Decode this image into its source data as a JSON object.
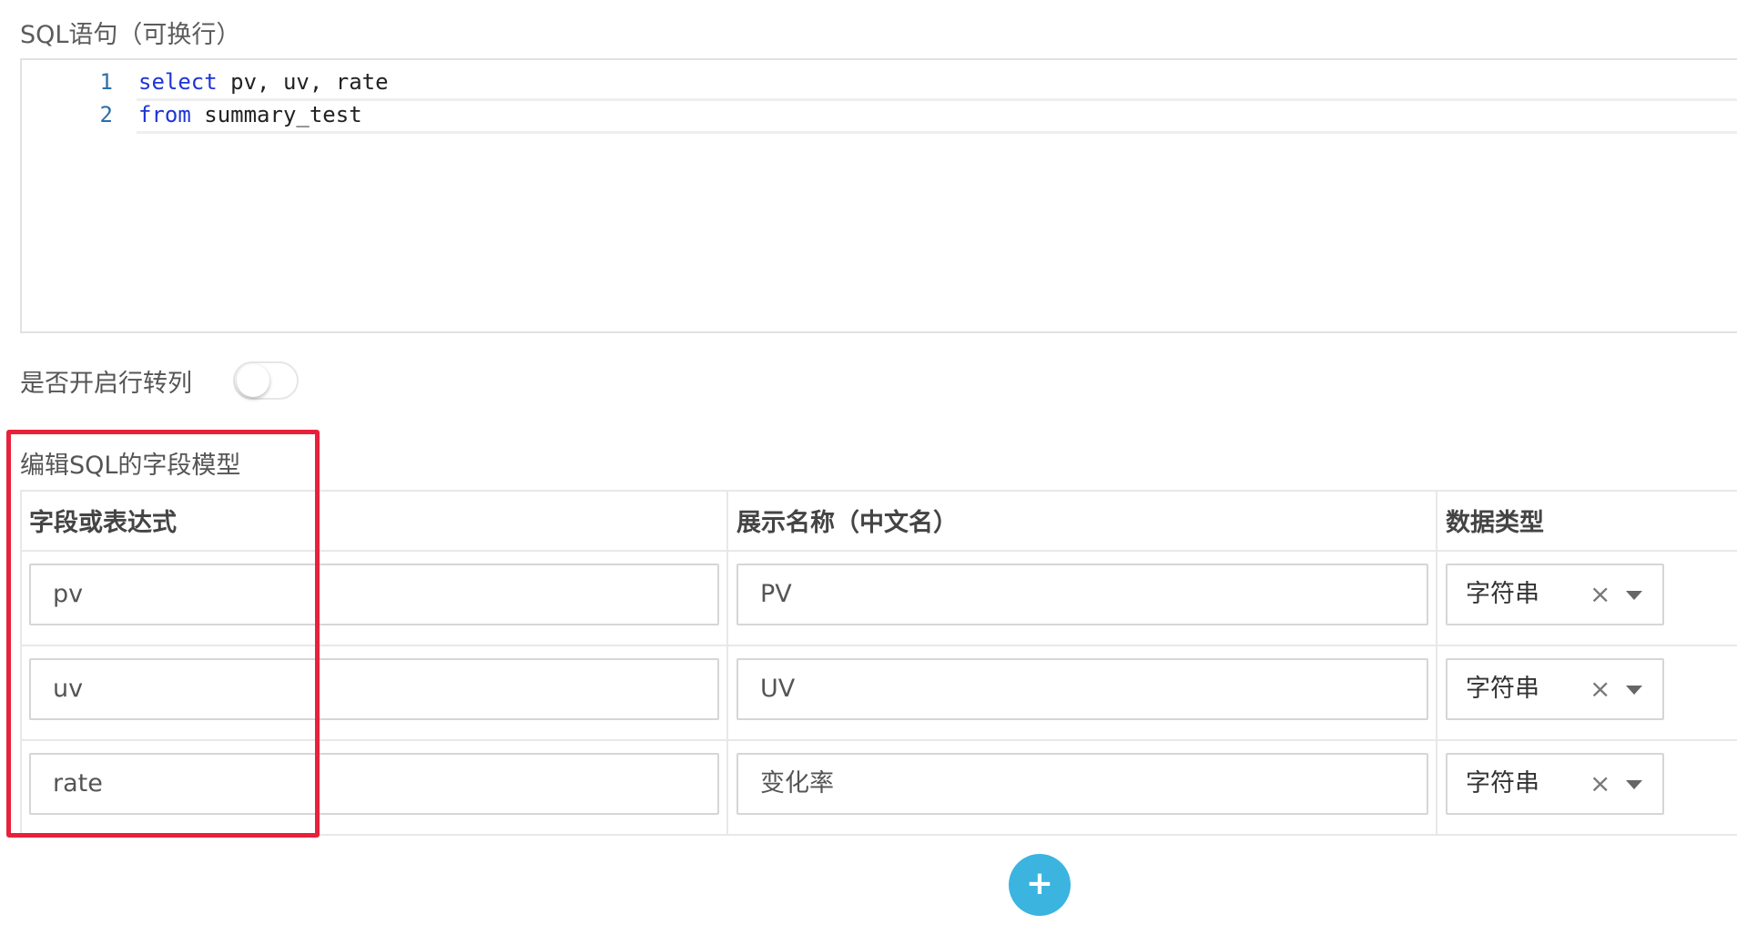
{
  "sql_section": {
    "label": "SQL语句（可换行）",
    "lines": [
      {
        "number": "1",
        "keyword": "select",
        "rest": " pv, uv, rate"
      },
      {
        "number": "2",
        "keyword": "from",
        "rest": " summary_test"
      }
    ]
  },
  "toggle": {
    "label": "是否开启行转列",
    "on": false
  },
  "model_section": {
    "label": "编辑SQL的字段模型",
    "columns": [
      "字段或表达式",
      "展示名称（中文名）",
      "数据类型"
    ],
    "rows": [
      {
        "field": "pv",
        "display": "PV",
        "type": "字符串"
      },
      {
        "field": "uv",
        "display": "UV",
        "type": "字符串"
      },
      {
        "field": "rate",
        "display": "变化率",
        "type": "字符串"
      }
    ]
  },
  "icons": {
    "clear": "×",
    "add": "+"
  },
  "colors": {
    "keyword": "#1f35d6",
    "highlight_border": "#e8213b",
    "add_button": "#3bb4e0"
  }
}
